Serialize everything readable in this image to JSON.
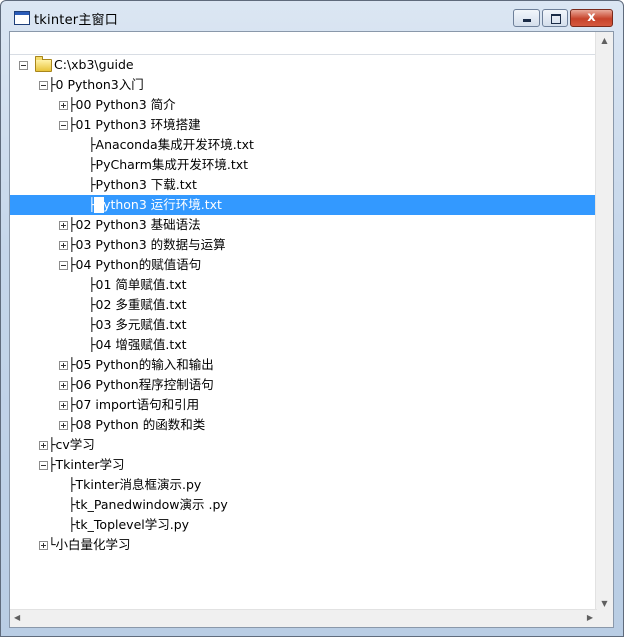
{
  "window": {
    "title": "tkinter主窗口",
    "close_glyph": "x"
  },
  "tree": {
    "root": "C:\\xb3\\guide",
    "items": [
      {
        "label": "├0 Python3入门",
        "level": 1,
        "toggle": "minus"
      },
      {
        "label": "├00 Python3 简介",
        "level": 2,
        "toggle": "plus"
      },
      {
        "label": "├01 Python3 环境搭建",
        "level": 2,
        "toggle": "minus"
      },
      {
        "label": "├Anaconda集成开发环境.txt",
        "level": 3,
        "toggle": "none"
      },
      {
        "label": "├PyCharm集成开发环境.txt",
        "level": 3,
        "toggle": "none"
      },
      {
        "label": "├Python3 下载.txt",
        "level": 3,
        "toggle": "none"
      },
      {
        "label": "├Python3 运行环境.txt",
        "level": 3,
        "toggle": "none",
        "selected": true
      },
      {
        "label": "├02 Python3 基础语法",
        "level": 2,
        "toggle": "plus"
      },
      {
        "label": "├03 Python3 的数据与运算",
        "level": 2,
        "toggle": "plus"
      },
      {
        "label": "├04 Python的赋值语句",
        "level": 2,
        "toggle": "minus"
      },
      {
        "label": "├01 简单赋值.txt",
        "level": 3,
        "toggle": "none"
      },
      {
        "label": "├02 多重赋值.txt",
        "level": 3,
        "toggle": "none"
      },
      {
        "label": "├03 多元赋值.txt",
        "level": 3,
        "toggle": "none"
      },
      {
        "label": "├04 增强赋值.txt",
        "level": 3,
        "toggle": "none"
      },
      {
        "label": "├05 Python的输入和输出",
        "level": 2,
        "toggle": "plus"
      },
      {
        "label": "├06 Python程序控制语句",
        "level": 2,
        "toggle": "plus"
      },
      {
        "label": "├07 import语句和引用",
        "level": 2,
        "toggle": "plus"
      },
      {
        "label": "├08 Python 的函数和类",
        "level": 2,
        "toggle": "plus"
      },
      {
        "label": "├cv学习",
        "level": 1,
        "toggle": "plus"
      },
      {
        "label": "├Tkinter学习",
        "level": 1,
        "toggle": "minus"
      },
      {
        "label": "├Tkinter消息框演示.py",
        "level": 2,
        "toggle": "none"
      },
      {
        "label": "├tk_Panedwindow演示 .py",
        "level": 2,
        "toggle": "none"
      },
      {
        "label": "├tk_Toplevel学习.py",
        "level": 2,
        "toggle": "none"
      },
      {
        "label": "└小白量化学习",
        "level": 1,
        "toggle": "plus"
      }
    ]
  },
  "scrollbars": {
    "up": "▲",
    "down": "▼",
    "left": "◀",
    "right": "▶"
  }
}
